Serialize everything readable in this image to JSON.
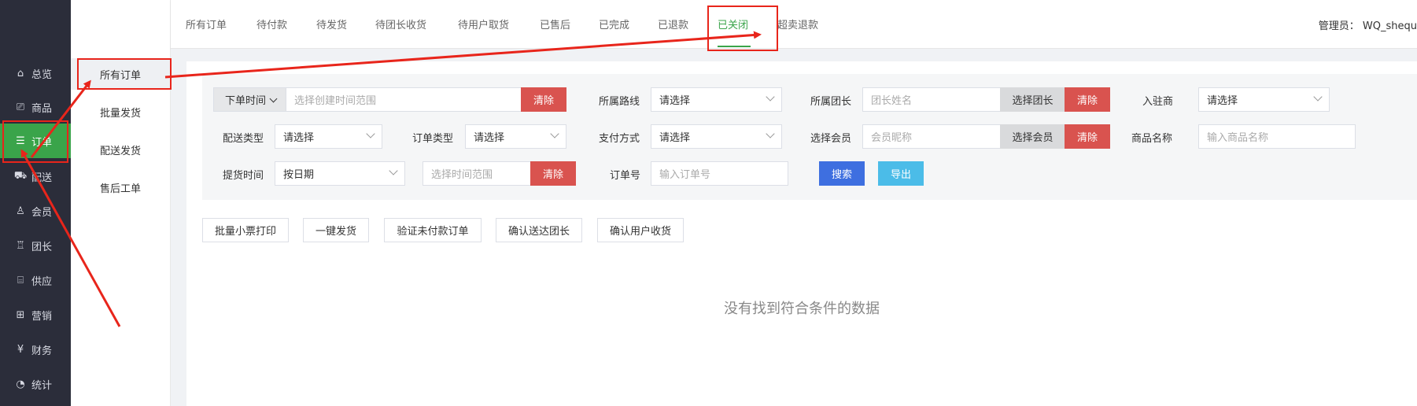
{
  "sidebar": {
    "items": [
      {
        "label": "总览",
        "icon": "home-icon",
        "glyph": "⌂"
      },
      {
        "label": "商品",
        "icon": "bag-icon",
        "glyph": "⎚"
      },
      {
        "label": "订单",
        "icon": "order-icon",
        "glyph": "☰"
      },
      {
        "label": "配送",
        "icon": "delivery-icon",
        "glyph": "⛟"
      },
      {
        "label": "会员",
        "icon": "user-icon",
        "glyph": "♙"
      },
      {
        "label": "团长",
        "icon": "leader-icon",
        "glyph": "♖"
      },
      {
        "label": "供应",
        "icon": "store-icon",
        "glyph": "⌸"
      },
      {
        "label": "营销",
        "icon": "gift-icon",
        "glyph": "⊞"
      },
      {
        "label": "财务",
        "icon": "finance-icon",
        "glyph": "¥"
      },
      {
        "label": "统计",
        "icon": "pie-chart-icon",
        "glyph": "◔"
      }
    ]
  },
  "submenu": {
    "items": [
      "所有订单",
      "批量发货",
      "配送发货",
      "售后工单"
    ]
  },
  "tabs": [
    "所有订单",
    "待付款",
    "待发货",
    "待团长收货",
    "待用户取货",
    "已售后",
    "已完成",
    "已退款",
    "已关闭",
    "超卖退款"
  ],
  "admin": "管理员： WQ_shequ",
  "filter": {
    "order_time_label": "下单时间",
    "order_time_placeholder": "选择创建时间范围",
    "clear": "清除",
    "route_label": "所属路线",
    "select_placeholder": "请选择",
    "leader_label": "所属团长",
    "leader_placeholder": "团长姓名",
    "choose_leader": "选择团长",
    "merchant_label": "入驻商",
    "delivery_type_label": "配送类型",
    "order_type_label": "订单类型",
    "pay_method_label": "支付方式",
    "member_label": "选择会员",
    "member_placeholder": "会员昵称",
    "choose_member": "选择会员",
    "goods_label": "商品名称",
    "goods_placeholder": "输入商品名称",
    "pickup_label": "提货时间",
    "pickup_value": "按日期",
    "pickup_placeholder": "选择时间范围",
    "order_no_label": "订单号",
    "order_no_placeholder": "输入订单号",
    "search": "搜索",
    "export": "导出"
  },
  "actions": [
    "批量小票打印",
    "一键发货",
    "验证未付款订单",
    "确认送达团长",
    "确认用户收货"
  ],
  "empty_text": "没有找到符合条件的数据",
  "colors": {
    "accent": "#3aa44a",
    "sidebar": "#2b2d3a",
    "danger": "#d9534f",
    "primary": "#3e6fe0",
    "annotation": "#e8251b"
  }
}
